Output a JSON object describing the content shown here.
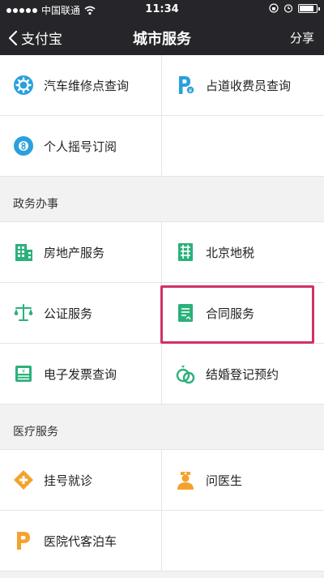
{
  "status_bar": {
    "carrier": "中国联通",
    "time": "11:34"
  },
  "nav": {
    "back_label": "支付宝",
    "title": "城市服务",
    "share_label": "分享"
  },
  "section0": {
    "items": [
      {
        "label": "汽车维修点查询"
      },
      {
        "label": "占道收费员查询"
      },
      {
        "label": "个人摇号订阅"
      }
    ]
  },
  "section1": {
    "title": "政务办事",
    "items": [
      {
        "label": "房地产服务"
      },
      {
        "label": "北京地税"
      },
      {
        "label": "公证服务"
      },
      {
        "label": "合同服务"
      },
      {
        "label": "电子发票查询"
      },
      {
        "label": "结婚登记预约"
      }
    ]
  },
  "section2": {
    "title": "医疗服务",
    "items": [
      {
        "label": "挂号就诊"
      },
      {
        "label": "问医生"
      },
      {
        "label": "医院代客泊车"
      }
    ]
  },
  "colors": {
    "nav_bg": "#26262a",
    "blue": "#2aa0dd",
    "green": "#2bb17a",
    "orange": "#f4a22d",
    "highlight": "#d1306b"
  }
}
